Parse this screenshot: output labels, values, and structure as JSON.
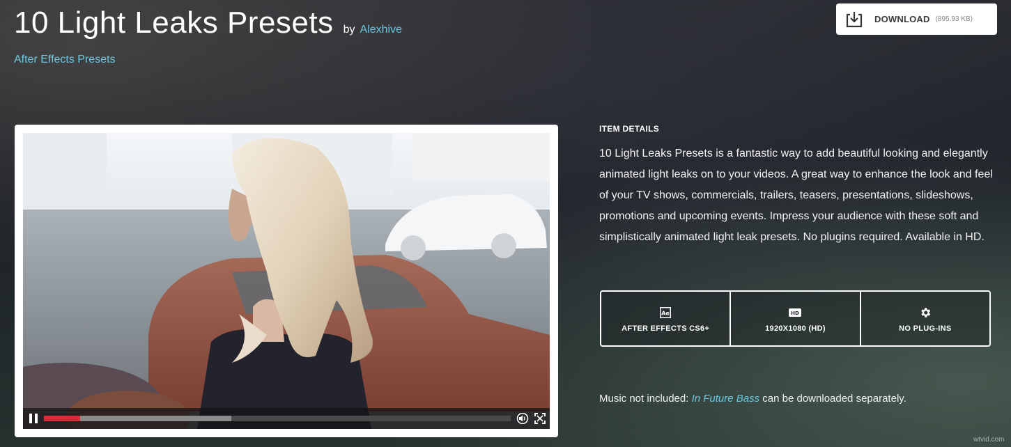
{
  "header": {
    "title": "10 Light Leaks Presets",
    "by_label": "by",
    "author": "Alexhive",
    "category": "After Effects Presets"
  },
  "download": {
    "label": "DOWNLOAD",
    "size": "(895.93 KB)",
    "icon": "download-icon"
  },
  "player": {
    "progress_played": 0.078,
    "progress_buffered": 0.402,
    "icons": [
      "pause-icon",
      "volume-icon",
      "fullscreen-icon"
    ]
  },
  "details": {
    "heading": "ITEM DETAILS",
    "description": "10 Light Leaks Presets is a fantastic way to add beautiful looking and elegantly animated light leaks on to your videos. A great way to enhance the look and feel of your TV shows, commercials, trailers, teasers, presentations, slideshows, promotions and upcoming events. Impress your audience with these soft and simplistically animated light leak presets. No plugins required. Available in HD."
  },
  "features": [
    {
      "icon": "after-effects-icon",
      "icon_text": "Ae",
      "label": "AFTER EFFECTS CS6+"
    },
    {
      "icon": "hd-icon",
      "icon_text": "HD",
      "label": "1920X1080 (HD)"
    },
    {
      "icon": "gear-icon",
      "label": "NO PLUG-INS"
    }
  ],
  "music": {
    "prefix": "Music not included: ",
    "link": "In Future Bass",
    "suffix": " can be downloaded separately."
  },
  "watermark": "wtvid.com",
  "colors": {
    "accent": "#6cc7e0",
    "progress_played": "#d32f3a"
  }
}
